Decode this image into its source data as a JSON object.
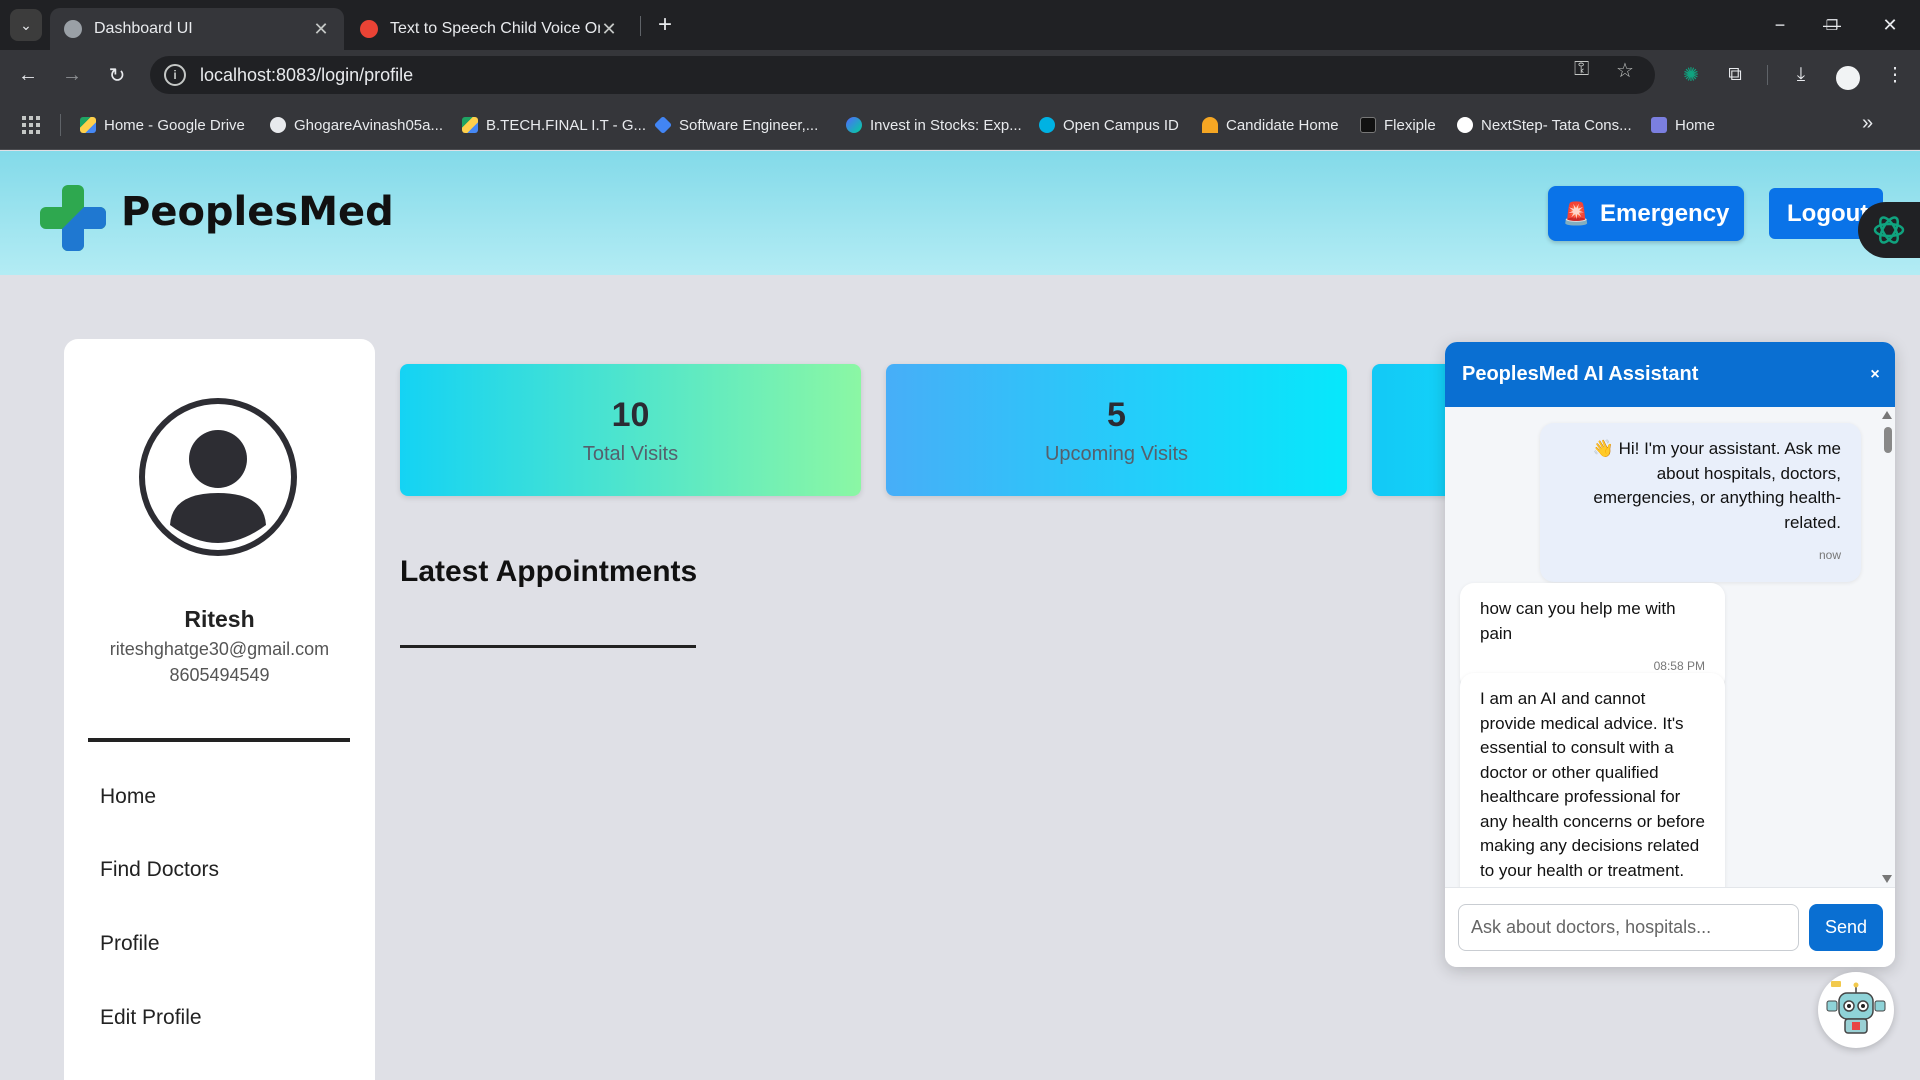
{
  "browser": {
    "tabs": [
      {
        "title": "Dashboard UI",
        "active": true
      },
      {
        "title": "Text to Speech Child Voice Onli",
        "active": false
      }
    ],
    "url": "localhost:8083/login/profile",
    "bookmarks": [
      {
        "label": "Home - Google Drive",
        "color": "#1fa463"
      },
      {
        "label": "GhogareAvinash05a...",
        "color": "#e8eaed"
      },
      {
        "label": "B.TECH.FINAL I.T - G...",
        "color": "#f4b400"
      },
      {
        "label": "Software Engineer,...",
        "color": "#4285f4"
      },
      {
        "label": "Invest in Stocks: Exp...",
        "color": "#6c5ce7"
      },
      {
        "label": "Open Campus ID",
        "color": "#00b2e3"
      },
      {
        "label": "Candidate Home",
        "color": "#f5a623"
      },
      {
        "label": "Flexiple",
        "color": "#111111"
      },
      {
        "label": "NextStep- Tata Cons...",
        "color": "#ffffff"
      },
      {
        "label": "Home",
        "color": "#7b7fe0"
      }
    ]
  },
  "header": {
    "brand": "PeoplesMed",
    "emergency_label": "Emergency",
    "logout_label": "Logout"
  },
  "profile": {
    "name": "Ritesh",
    "email": "riteshghatge30@gmail.com",
    "phone": "8605494549"
  },
  "nav": {
    "items": [
      "Home",
      "Find Doctors",
      "Profile",
      "Edit Profile"
    ]
  },
  "stats": [
    {
      "value": "10",
      "label": "Total Visits"
    },
    {
      "value": "5",
      "label": "Upcoming Visits"
    }
  ],
  "appointments": {
    "title": "Latest Appointments"
  },
  "chat": {
    "title": "PeoplesMed AI Assistant",
    "close_label": "×",
    "messages": [
      {
        "from": "bot",
        "text": "👋 Hi! I'm your assistant. Ask me about hospitals, doctors, emergencies, or anything health-related.",
        "time": "now"
      },
      {
        "from": "user",
        "text": "how can you help me with pain",
        "time": "08:58 PM"
      },
      {
        "from": "bot",
        "text": "I am an AI and cannot provide medical advice. It's essential to consult with a doctor or other qualified healthcare professional for any health concerns or before making any decisions related to your health or treatment."
      }
    ],
    "input_placeholder": "Ask about doctors, hospitals...",
    "send_label": "Send"
  },
  "colors": {
    "primary": "#0a73e8",
    "chat_header": "#0a6fd2"
  }
}
